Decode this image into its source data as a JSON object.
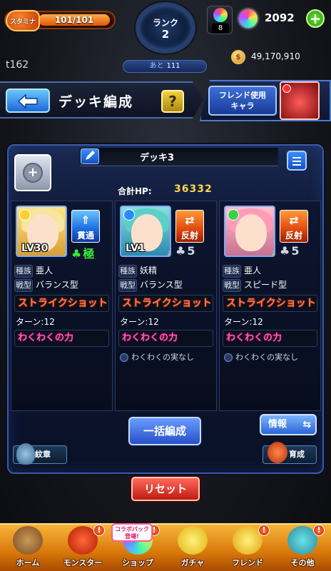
{
  "status": {
    "stamina_label": "スタミナ",
    "stamina_value": "101/101",
    "stamina_fraction": 1.0,
    "rank_label": "ランク",
    "rank_value": "2",
    "rank_next_label": "あと",
    "rank_next_value": "111",
    "orb_stock": "8",
    "gems": "2092",
    "gold": "49,170,910",
    "user_tag": "t162"
  },
  "header": {
    "title": "デッキ編成",
    "help_label": "?",
    "friend_button_line1": "フレンド使用",
    "friend_button_line2": "キャラ"
  },
  "deck": {
    "name": "デッキ3",
    "total_hp_label": "合計HP:",
    "total_hp_value": "36332",
    "cards": [
      {
        "level": "LV30",
        "gimmick": "貫通",
        "luck": "極",
        "race_key": "種族",
        "race": "亜人",
        "type_key": "戦型",
        "type": "バランス型",
        "skill": "ストライクショット",
        "turn": "ターン:12",
        "waku": "わくわくの力",
        "fruit": ""
      },
      {
        "level": "LV1",
        "gimmick": "反射",
        "luck": "5",
        "race_key": "種族",
        "race": "妖精",
        "type_key": "戦型",
        "type": "バランス型",
        "skill": "ストライクショット",
        "turn": "ターン:12",
        "waku": "わくわくの力",
        "fruit": "わくわくの実なし"
      },
      {
        "level": "",
        "gimmick": "反射",
        "luck": "5",
        "race_key": "種族",
        "race": "亜人",
        "type_key": "戦型",
        "type": "スピード型",
        "skill": "ストライクショット",
        "turn": "ターン:12",
        "waku": "わくわくの力",
        "fruit": "わくわくの実なし"
      }
    ]
  },
  "actions": {
    "bulk": "一括編成",
    "info": "情報",
    "crest": "紋章",
    "train": "育成",
    "reset": "リセット"
  },
  "nav": {
    "collab_badge_line1": "コラボパック",
    "collab_badge_line2": "登場!",
    "items": [
      {
        "label": "ホーム",
        "alert": ""
      },
      {
        "label": "モンスター",
        "alert": "!"
      },
      {
        "label": "ショップ",
        "alert": "!"
      },
      {
        "label": "ガチャ",
        "alert": ""
      },
      {
        "label": "フレンド",
        "alert": "!"
      },
      {
        "label": "その他",
        "alert": "!"
      }
    ]
  },
  "colors": {
    "accent": "#1d68d6",
    "hp": "#ffd84a",
    "skill": "#ff7a4a",
    "waku": "#ff5ab8",
    "luck_max": "#3aea3a"
  }
}
